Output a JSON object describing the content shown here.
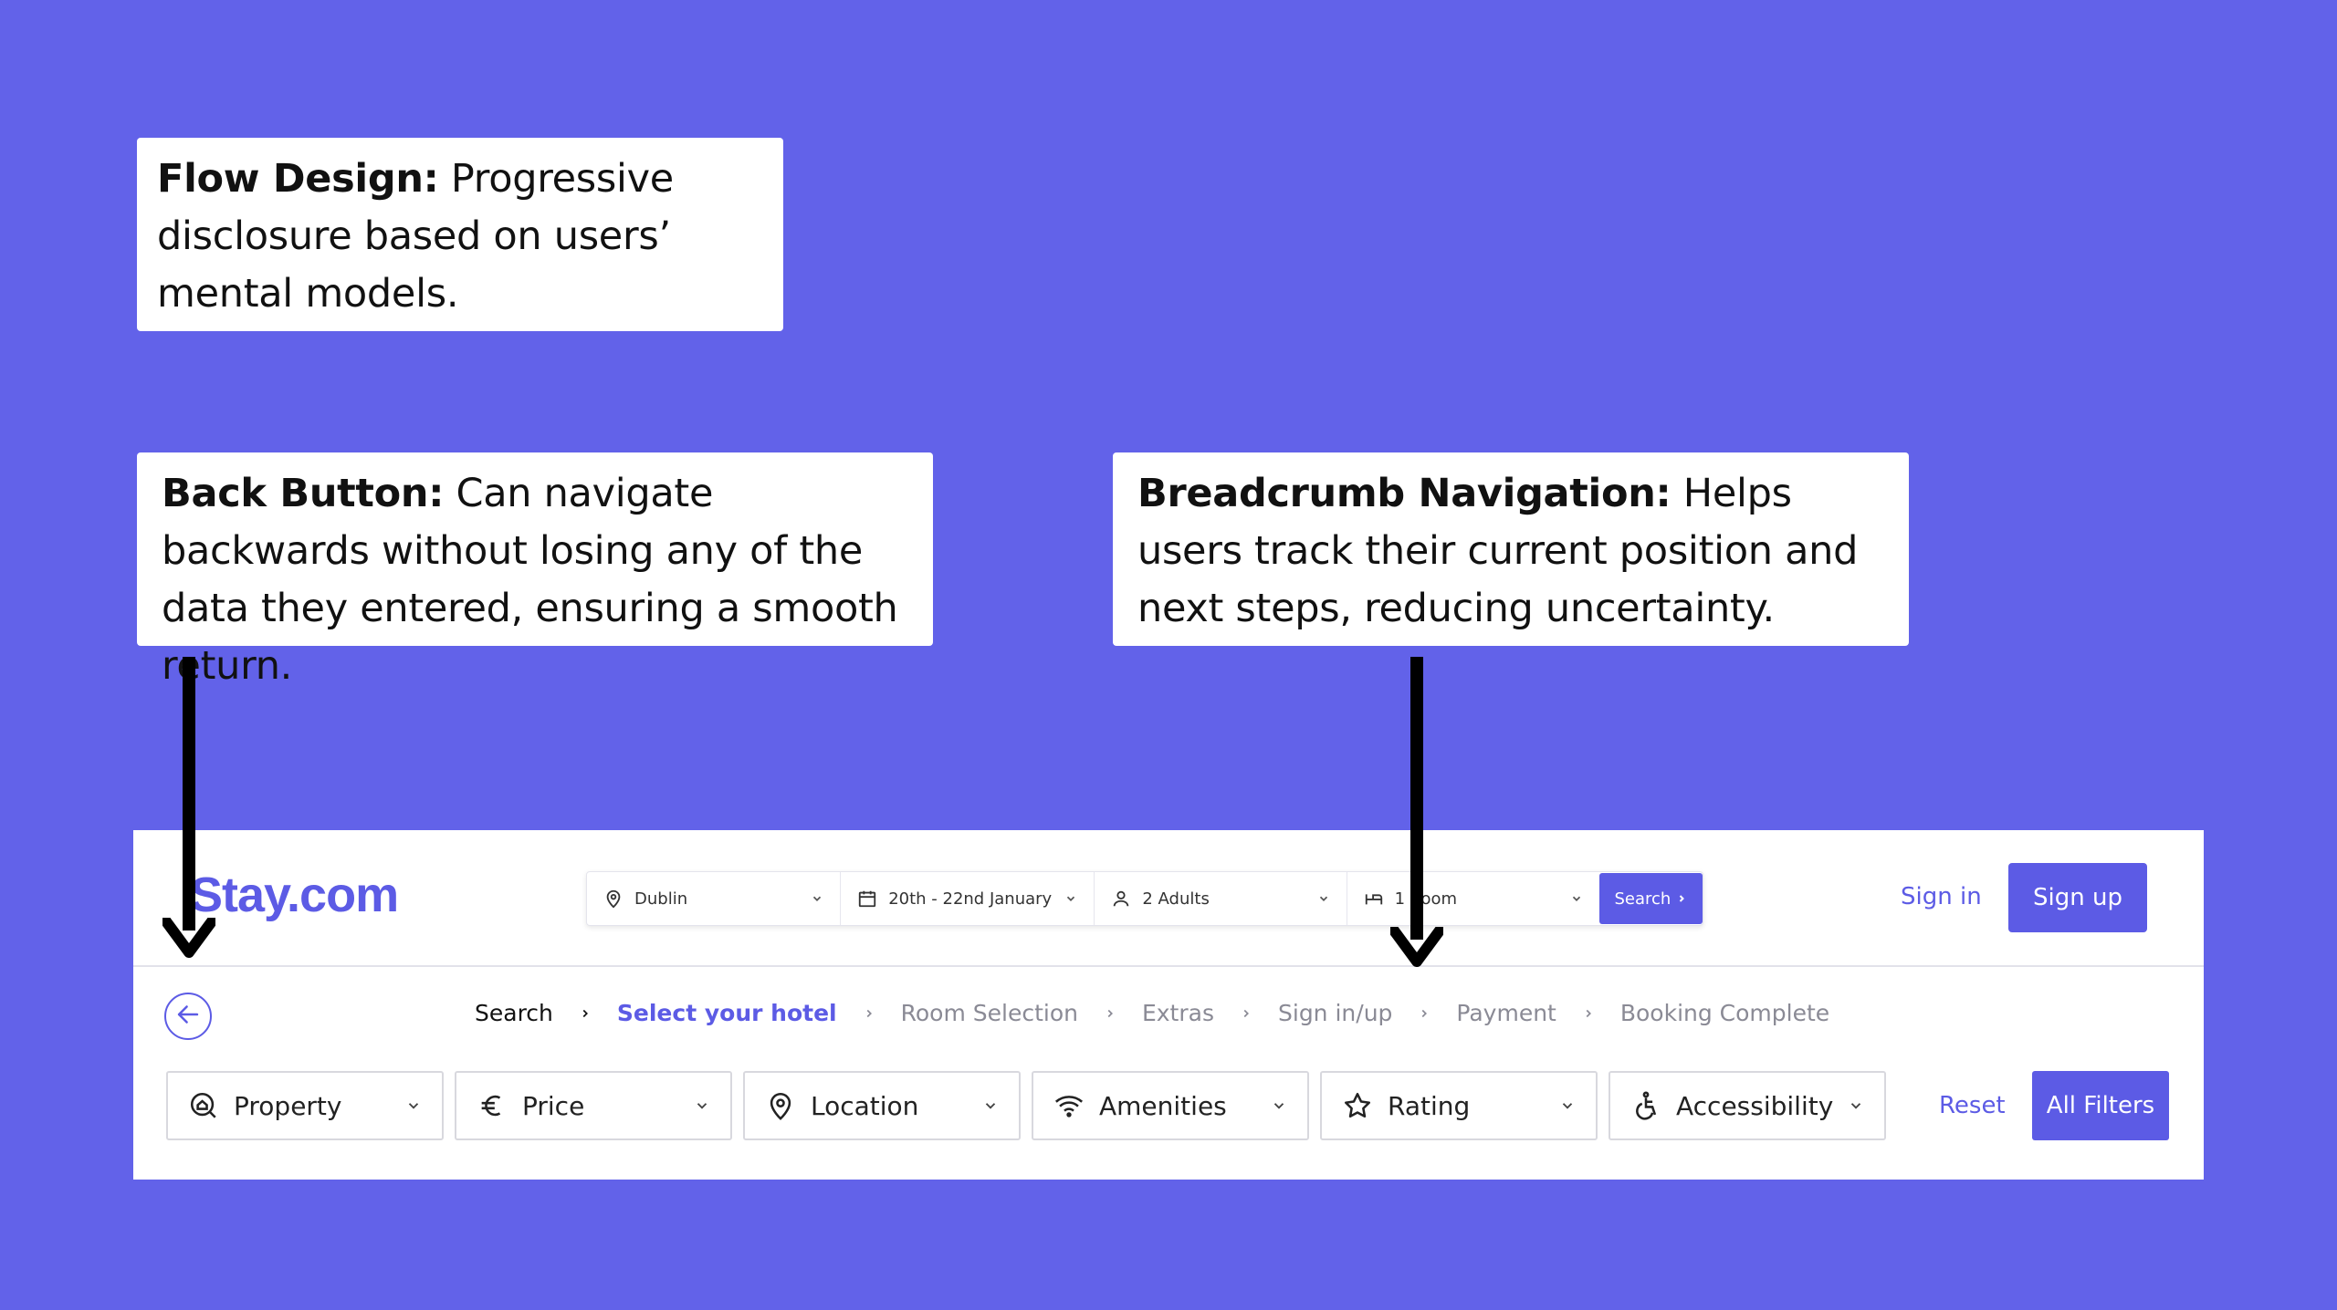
{
  "colors": {
    "background": "#6262E9",
    "accent": "#5C5BE5",
    "panel": "#ffffff"
  },
  "callouts": {
    "flow": {
      "title": "Flow Design:",
      "text": "Progressive disclosure based on users’ mental models."
    },
    "back": {
      "title": "Back Button:",
      "text": "Can navigate backwards without losing any of the data they entered, ensuring a smooth return."
    },
    "breadcrumb": {
      "title": "Breadcrumb Navigation:",
      "text": "Helps users track their current position and next steps, reducing uncertainty."
    }
  },
  "header": {
    "logo": "Stay.com",
    "search": {
      "city": "Dublin",
      "dates": "20th - 22nd January",
      "guests": "2  Adults",
      "rooms": "1 Room",
      "button": "Search"
    },
    "sign_in": "Sign in",
    "sign_up": "Sign up"
  },
  "breadcrumb": [
    {
      "label": "Search",
      "state": "done"
    },
    {
      "label": "Select your hotel",
      "state": "current"
    },
    {
      "label": "Room Selection",
      "state": "upcoming"
    },
    {
      "label": "Extras",
      "state": "upcoming"
    },
    {
      "label": "Sign in/up",
      "state": "upcoming"
    },
    {
      "label": "Payment",
      "state": "upcoming"
    },
    {
      "label": "Booking Complete",
      "state": "upcoming"
    }
  ],
  "filters": [
    {
      "label": "Property",
      "icon": "home-search-icon"
    },
    {
      "label": "Price",
      "icon": "euro-icon"
    },
    {
      "label": "Location",
      "icon": "location-pin-icon"
    },
    {
      "label": "Amenities",
      "icon": "wifi-icon"
    },
    {
      "label": "Rating",
      "icon": "star-icon"
    },
    {
      "label": "Accessibility",
      "icon": "wheelchair-icon"
    }
  ],
  "filter_actions": {
    "reset": "Reset",
    "all_filters": "All Filters"
  }
}
